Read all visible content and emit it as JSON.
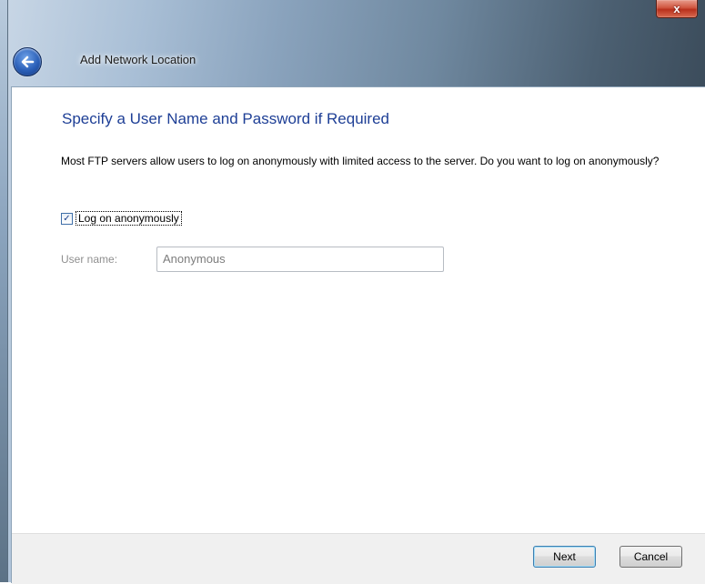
{
  "window": {
    "title": "Add Network Location",
    "close_glyph": "x"
  },
  "page": {
    "heading": "Specify a User Name and Password if Required",
    "description": "Most FTP servers allow users to log on anonymously with limited access to the server.  Do you want to log on anonymously?"
  },
  "anonymous_checkbox": {
    "label": "Log on anonymously",
    "checked": true,
    "glyph": "✓"
  },
  "username": {
    "label": "User name:",
    "value": "Anonymous",
    "enabled": false
  },
  "buttons": {
    "next_label": "Next",
    "cancel_label": "Cancel"
  },
  "icons": {
    "back": "back-arrow-icon",
    "close": "close-icon"
  },
  "colors": {
    "heading": "#1e3f96",
    "disabled_text": "#8f8f8f",
    "close_button": "#c7432c"
  }
}
